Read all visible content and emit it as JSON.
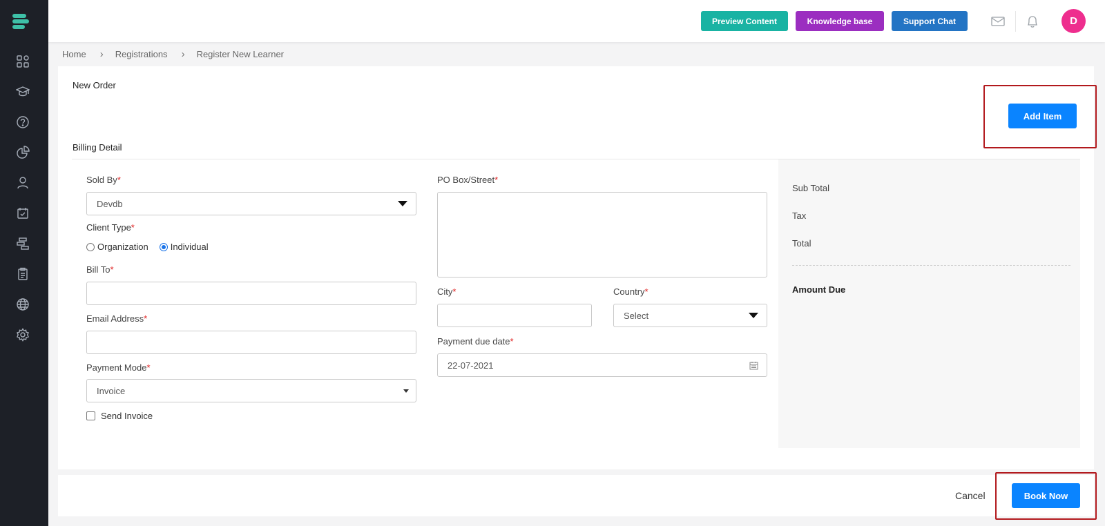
{
  "topbar": {
    "preview_label": "Preview Content",
    "knowledge_label": "Knowledge base",
    "support_label": "Support Chat",
    "avatar_initial": "D",
    "colors": {
      "preview": "#19b3a3",
      "knowledge": "#9b2ec0",
      "support": "#2374c4",
      "avatar": "#ee2e8e"
    }
  },
  "sidebar": {
    "icons": [
      "dashboard-icon",
      "graduation-cap-icon",
      "help-icon",
      "pie-chart-icon",
      "user-icon",
      "calendar-icon",
      "workflow-icon",
      "clipboard-icon",
      "globe-icon",
      "settings-icon"
    ]
  },
  "breadcrumb": [
    "Home",
    "Registrations",
    "Register New Learner"
  ],
  "page": {
    "new_order_title": "New Order",
    "add_item_label": "Add Item",
    "billing_title": "Billing Detail"
  },
  "form": {
    "sold_by_label": "Sold By",
    "sold_by_value": "Devdb",
    "client_type_label": "Client Type",
    "client_type_options": [
      "Organization",
      "Individual"
    ],
    "client_type_selected": "Individual",
    "bill_to_label": "Bill To",
    "bill_to_value": "",
    "email_label": "Email Address",
    "email_value": "",
    "payment_mode_label": "Payment Mode",
    "payment_mode_value": "Invoice",
    "send_invoice_label": "Send Invoice",
    "po_box_label": "PO Box/Street",
    "city_label": "City",
    "country_label": "Country",
    "country_value": "Select",
    "payment_due_label": "Payment due date",
    "payment_due_value": "22-07-2021",
    "required_mark": "*"
  },
  "summary": {
    "subtotal_label": "Sub Total",
    "tax_label": "Tax",
    "total_label": "Total",
    "amount_due_label": "Amount Due"
  },
  "footer": {
    "cancel_label": "Cancel",
    "book_label": "Book Now"
  },
  "accent": {
    "primary": "#0a84ff",
    "annotation": "#b2191d"
  }
}
